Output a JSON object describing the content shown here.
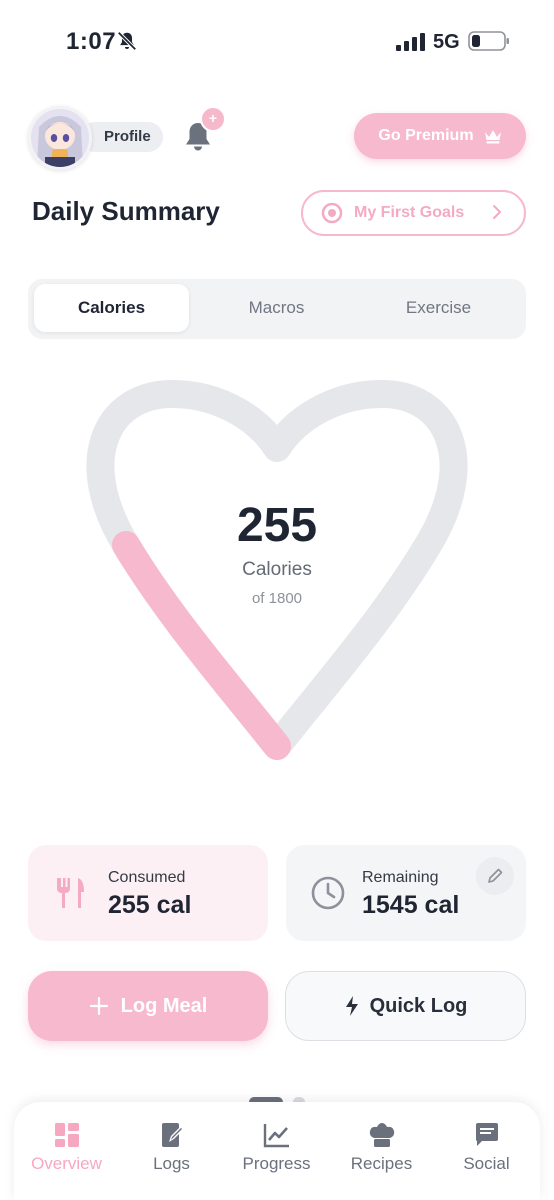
{
  "status_bar": {
    "time": "1:07",
    "network": "5G"
  },
  "header": {
    "profile_label": "Profile",
    "notification_badge": "+",
    "premium_label": "Go Premium"
  },
  "summary": {
    "title": "Daily Summary",
    "goals_label": "My First Goals"
  },
  "tabs": [
    {
      "label": "Calories",
      "active": true
    },
    {
      "label": "Macros",
      "active": false
    },
    {
      "label": "Exercise",
      "active": false
    }
  ],
  "calories": {
    "value": "255",
    "label": "Calories",
    "of_goal": "of 1800",
    "consumed": 255,
    "goal": 1800
  },
  "stats": {
    "consumed_label": "Consumed",
    "consumed_value": "255 cal",
    "remaining_label": "Remaining",
    "remaining_value": "1545 cal"
  },
  "actions": {
    "log_meal": "Log Meal",
    "quick_log": "Quick Log"
  },
  "bottom_nav": [
    {
      "label": "Overview",
      "icon": "dashboard-icon",
      "active": true
    },
    {
      "label": "Logs",
      "icon": "log-book-icon",
      "active": false
    },
    {
      "label": "Progress",
      "icon": "chart-icon",
      "active": false
    },
    {
      "label": "Recipes",
      "icon": "chef-hat-icon",
      "active": false
    },
    {
      "label": "Social",
      "icon": "chat-icon",
      "active": false
    }
  ],
  "colors": {
    "accent": "#f7b9cd",
    "track": "#e6e7ea",
    "text": "#1f2533"
  }
}
